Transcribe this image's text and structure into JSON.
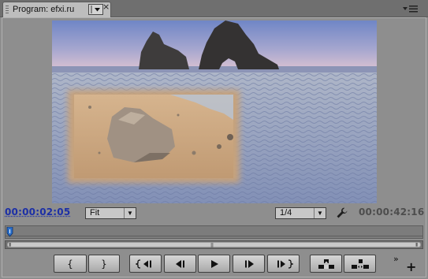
{
  "panel": {
    "tab_title": "Program: efxi.ru",
    "tab_menu_icon": "chevron-down-icon",
    "close_label": "×",
    "panel_menu_icon": "panel-menu-icon"
  },
  "monitor": {
    "current_timecode": "00:00:02:05",
    "duration_timecode": "00:00:42:16",
    "zoom_select": {
      "value": "Fit"
    },
    "resolution_select": {
      "value": "1/4"
    },
    "settings_icon": "wrench-icon",
    "playhead_position": 0.0
  },
  "transport": {
    "mark_in_label": "{",
    "mark_out_label": "}",
    "buttons": [
      {
        "name": "mark-in-button",
        "icon": "mark-in-icon"
      },
      {
        "name": "mark-out-button",
        "icon": "mark-out-icon"
      },
      {
        "name": "go-to-in-button",
        "icon": "go-to-in-icon"
      },
      {
        "name": "step-back-button",
        "icon": "step-back-icon"
      },
      {
        "name": "play-button",
        "icon": "play-icon"
      },
      {
        "name": "step-forward-button",
        "icon": "step-forward-icon"
      },
      {
        "name": "go-to-out-button",
        "icon": "go-to-out-icon"
      },
      {
        "name": "lift-button",
        "icon": "lift-icon"
      },
      {
        "name": "extract-button",
        "icon": "extract-icon"
      }
    ],
    "more_label": "»",
    "add_label": "+"
  },
  "colors": {
    "timecode_accent": "#1c2fa6",
    "panel_bg": "#8e8e8e",
    "playhead": "#2b6fc9"
  }
}
